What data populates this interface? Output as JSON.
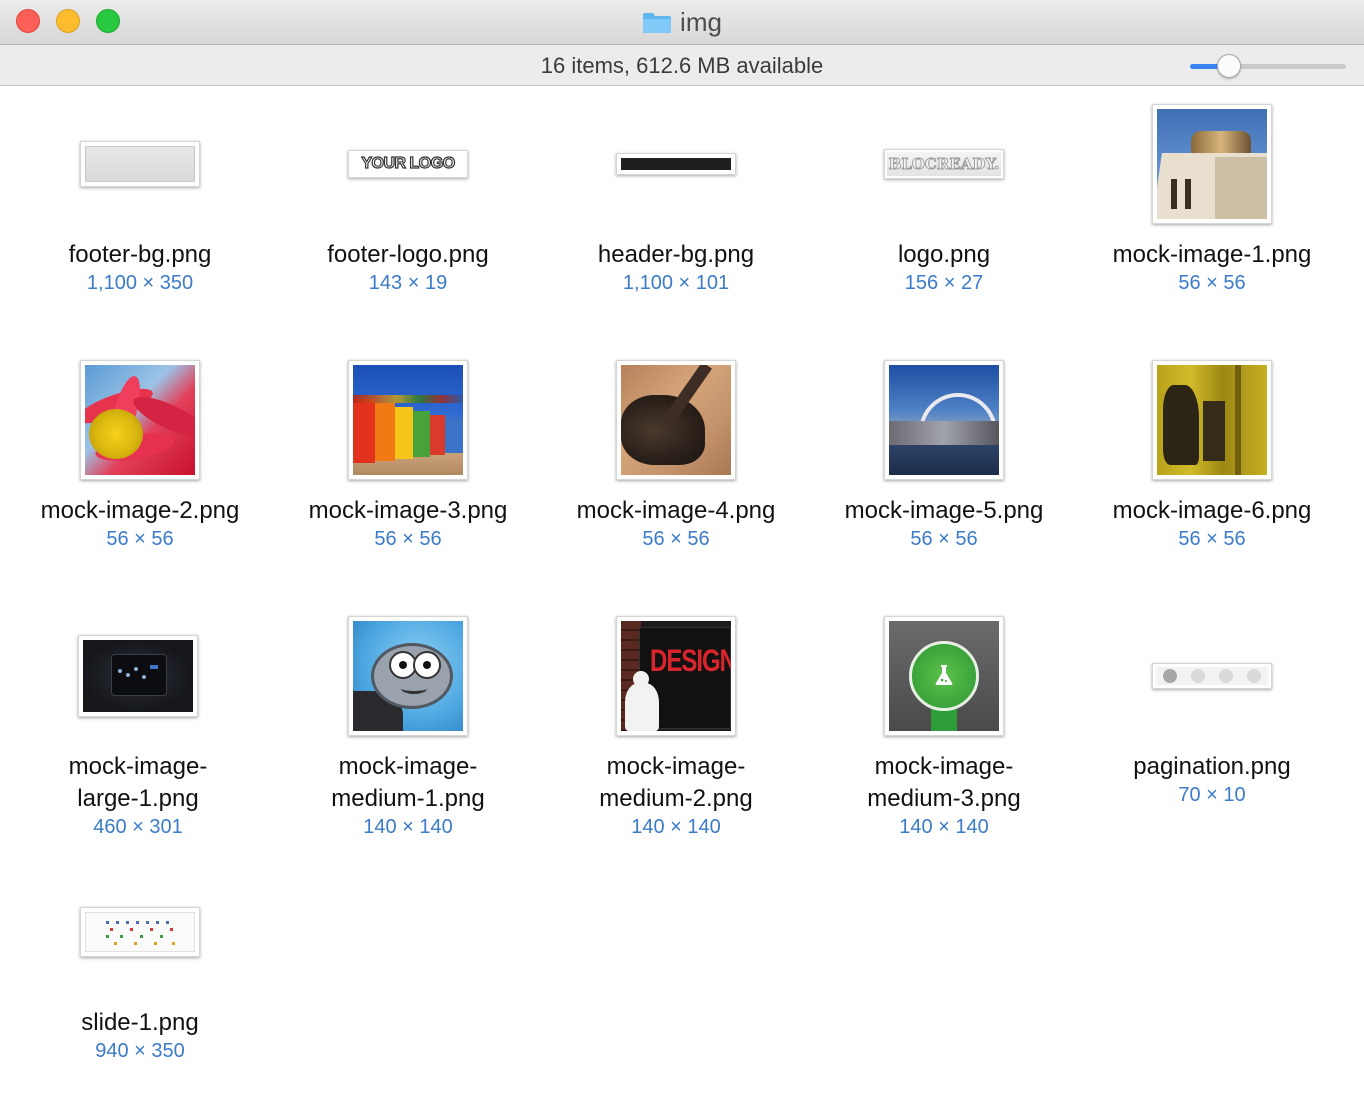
{
  "window": {
    "title": "img",
    "status": "16 items, 612.6 MB available",
    "zoom_slider_value": 0.25
  },
  "files": [
    {
      "name": "footer-bg.png",
      "dims": "1,100 × 350"
    },
    {
      "name": "footer-logo.png",
      "dims": "143 × 19",
      "logo_text": "YOUR LOGO"
    },
    {
      "name": "header-bg.png",
      "dims": "1,100 × 101"
    },
    {
      "name": "logo.png",
      "dims": "156 × 27",
      "logo_text": "BLOCREADY."
    },
    {
      "name": "mock-image-1.png",
      "dims": "56 × 56"
    },
    {
      "name": "mock-image-2.png",
      "dims": "56 × 56"
    },
    {
      "name": "mock-image-3.png",
      "dims": "56 × 56"
    },
    {
      "name": "mock-image-4.png",
      "dims": "56 × 56"
    },
    {
      "name": "mock-image-5.png",
      "dims": "56 × 56"
    },
    {
      "name": "mock-image-6.png",
      "dims": "56 × 56"
    },
    {
      "name": "mock-image-large-1.png",
      "name_line1": "mock-image-",
      "name_line2": "large-1.png",
      "dims": "460 × 301"
    },
    {
      "name": "mock-image-medium-1.png",
      "name_line1": "mock-image-",
      "name_line2": "medium-1.png",
      "dims": "140 × 140"
    },
    {
      "name": "mock-image-medium-2.png",
      "name_line1": "mock-image-",
      "name_line2": "medium-2.png",
      "dims": "140 × 140",
      "poster_text": "DESIGN"
    },
    {
      "name": "mock-image-medium-3.png",
      "name_line1": "mock-image-",
      "name_line2": "medium-3.png",
      "dims": "140 × 140"
    },
    {
      "name": "pagination.png",
      "dims": "70 × 10"
    },
    {
      "name": "slide-1.png",
      "dims": "940 × 350"
    }
  ],
  "colors": {
    "accent": "#3a83f5",
    "dims_text": "#3c7bc9",
    "close": "#fc5f57",
    "minimize": "#fdbc2e",
    "zoom": "#28c840"
  }
}
